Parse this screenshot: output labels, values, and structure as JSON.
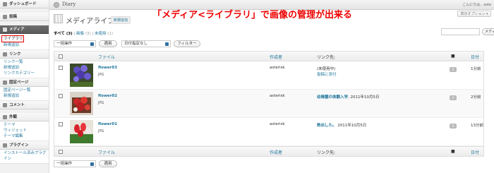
{
  "topbar": {
    "site_title": "Diary",
    "user_info": "こんにちは、aste",
    "screen_options": "表示オプション ▾"
  },
  "annotation": "「メディア<ライブラリ」で画像の管理が出来る",
  "sidebar": {
    "dashboard": "ダッシュボード",
    "posts": "投稿",
    "media": "メディア",
    "media_items": [
      "ライブラリ",
      "新規追加"
    ],
    "links": "リンク",
    "links_items": [
      "リンク一覧",
      "新規追加",
      "リンクカテゴリー"
    ],
    "pages": "固定ページ",
    "pages_items": [
      "固定ページ一覧",
      "新規追加"
    ],
    "comments": "コメント",
    "appearance": "外観",
    "appearance_items": [
      "テーマ",
      "ウィジェット",
      "テーマ編集"
    ],
    "plugins": "プラグイン",
    "plugins_items": [
      "インストール済みプラグイン"
    ]
  },
  "page": {
    "title": "メディアライブラリ",
    "add_new": "新規追加"
  },
  "filters": {
    "all": "すべて",
    "all_count": "(3)",
    "images": "画像",
    "images_count": "(3)",
    "unattached": "未使用",
    "unattached_count": "(1)"
  },
  "controls": {
    "bulk_action": "一括操作",
    "apply": "適用",
    "date_filter": "日付指定なし",
    "filter": "フィルター",
    "search_button": "メディ"
  },
  "table": {
    "headers": {
      "file": "ファイル",
      "author": "作成者",
      "attached": "リンク先:",
      "date": "日付"
    },
    "rows": [
      {
        "name": "flower03",
        "type": "JPG",
        "author": "asterisk",
        "attached_text": "(未使用中)",
        "attached_link": "投稿に添付",
        "comments": "0",
        "date": "1分前"
      },
      {
        "name": "flower02",
        "type": "JPG",
        "author": "asterisk",
        "attached_title": "幼稚園の体験入学",
        "attached_date": ", 2011年10月5日",
        "comments": "0",
        "date": "2分前"
      },
      {
        "name": "flower01",
        "type": "JPG",
        "author": "asterisk",
        "attached_title": "熱出した。",
        "attached_date": " 2011年10月5日",
        "comments": "0",
        "date": "13分前"
      }
    ]
  },
  "colors": {
    "annotation": "#ee0000",
    "link": "#21759b",
    "sidebar_active": "#5b5b5b"
  }
}
